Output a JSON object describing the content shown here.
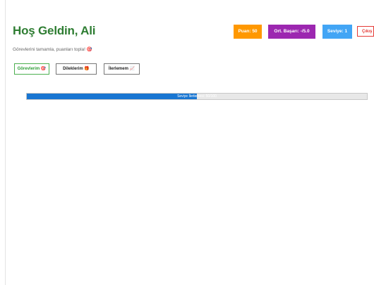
{
  "header": {
    "title": "Hoş Geldin, Ali",
    "subtitle": "Görevlerini tamamla, puanları topla! 🎯"
  },
  "stats": {
    "points_label": "Puan: 50",
    "avg_label": "Ort. Başarı: -/5.0",
    "level_label": "Seviye: 1"
  },
  "logout_label": "Çıkış",
  "tabs": [
    {
      "label": "Görevlerim 🎯",
      "active": true
    },
    {
      "label": "Dileklerim 🎁",
      "active": false
    },
    {
      "label": "İlerlemem 📈",
      "active": false
    }
  ],
  "level_progress": {
    "label": "Seviye İlerlemesi: 50/100",
    "value": 50,
    "max": 100
  },
  "colors": {
    "title": "#2e7d32",
    "points_badge": "#ff9800",
    "avg_badge": "#9c27b0",
    "level_badge": "#42a5f5",
    "logout": "#e53935",
    "active_tab": "#4caf50",
    "progress_fill": "#1976d2"
  }
}
